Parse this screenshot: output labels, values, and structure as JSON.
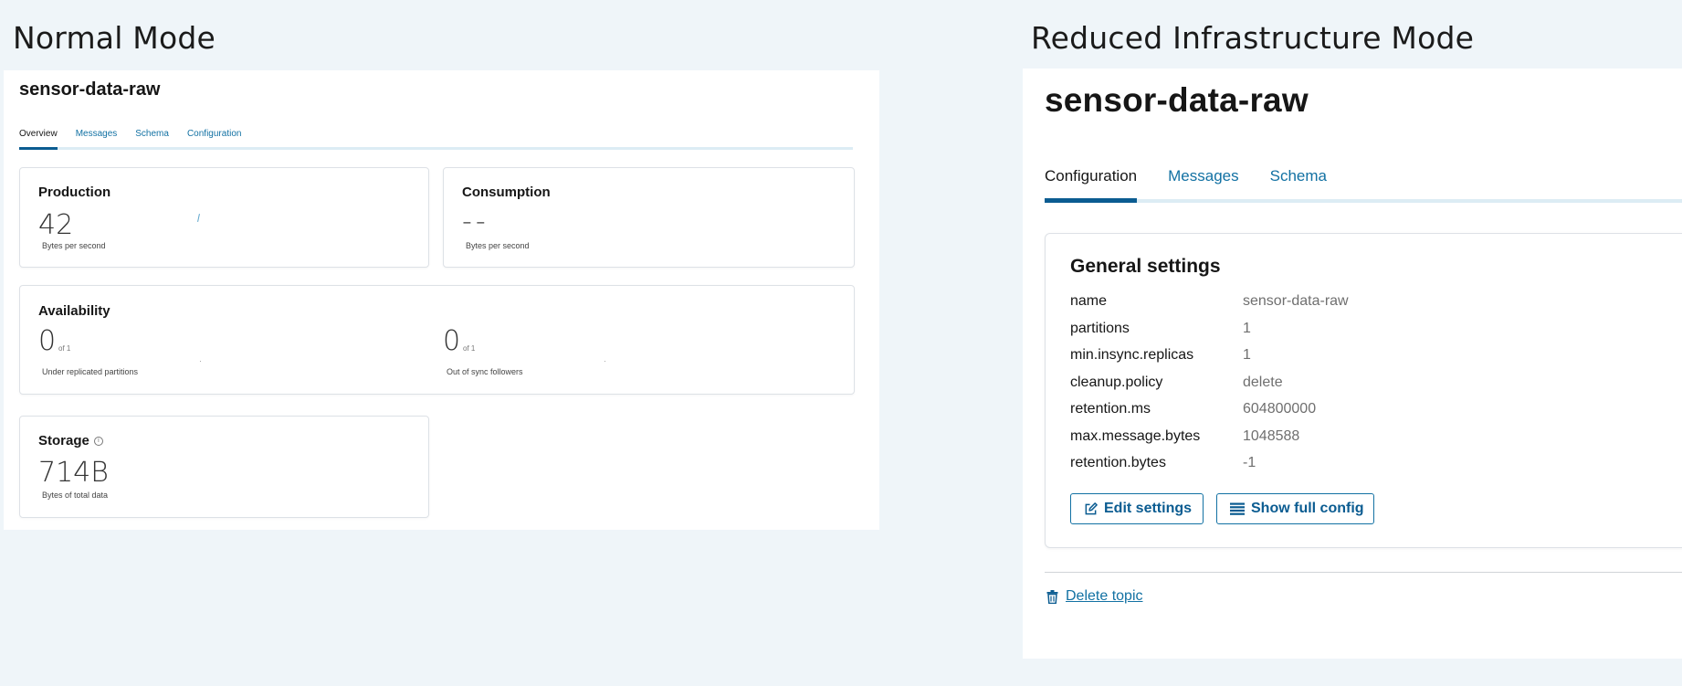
{
  "normal": {
    "mode_title": "Normal Mode",
    "topic_name": "sensor-data-raw",
    "tabs": [
      "Overview",
      "Messages",
      "Schema",
      "Configuration"
    ],
    "production": {
      "title": "Production",
      "value": "42",
      "unit": "Bytes per second"
    },
    "consumption": {
      "title": "Consumption",
      "value": "--",
      "unit": "Bytes per second"
    },
    "availability": {
      "title": "Availability",
      "under_replicated": {
        "value": "0",
        "of": "of 1",
        "label": "Under replicated partitions"
      },
      "out_of_sync": {
        "value": "0",
        "of": "of 1",
        "label": "Out of sync followers"
      }
    },
    "storage": {
      "title": "Storage",
      "value": "714B",
      "unit": "Bytes of total data",
      "info_icon": "info-icon"
    }
  },
  "reduced": {
    "mode_title": "Reduced Infrastructure Mode",
    "topic_name": "sensor-data-raw",
    "tabs": [
      "Configuration",
      "Messages",
      "Schema"
    ],
    "general_settings": {
      "title": "General settings",
      "rows": [
        {
          "key": "name",
          "value": "sensor-data-raw"
        },
        {
          "key": "partitions",
          "value": "1"
        },
        {
          "key": "min.insync.replicas",
          "value": "1"
        },
        {
          "key": "cleanup.policy",
          "value": "delete"
        },
        {
          "key": "retention.ms",
          "value": "604800000"
        },
        {
          "key": "max.message.bytes",
          "value": "1048588"
        },
        {
          "key": "retention.bytes",
          "value": "-1"
        }
      ],
      "edit_button": "Edit settings",
      "full_config_button": "Show full config"
    },
    "delete_link": "Delete topic"
  },
  "colors": {
    "background": "#eff5f9",
    "accent": "#1271a3",
    "tab_active": "#0b5c91"
  }
}
